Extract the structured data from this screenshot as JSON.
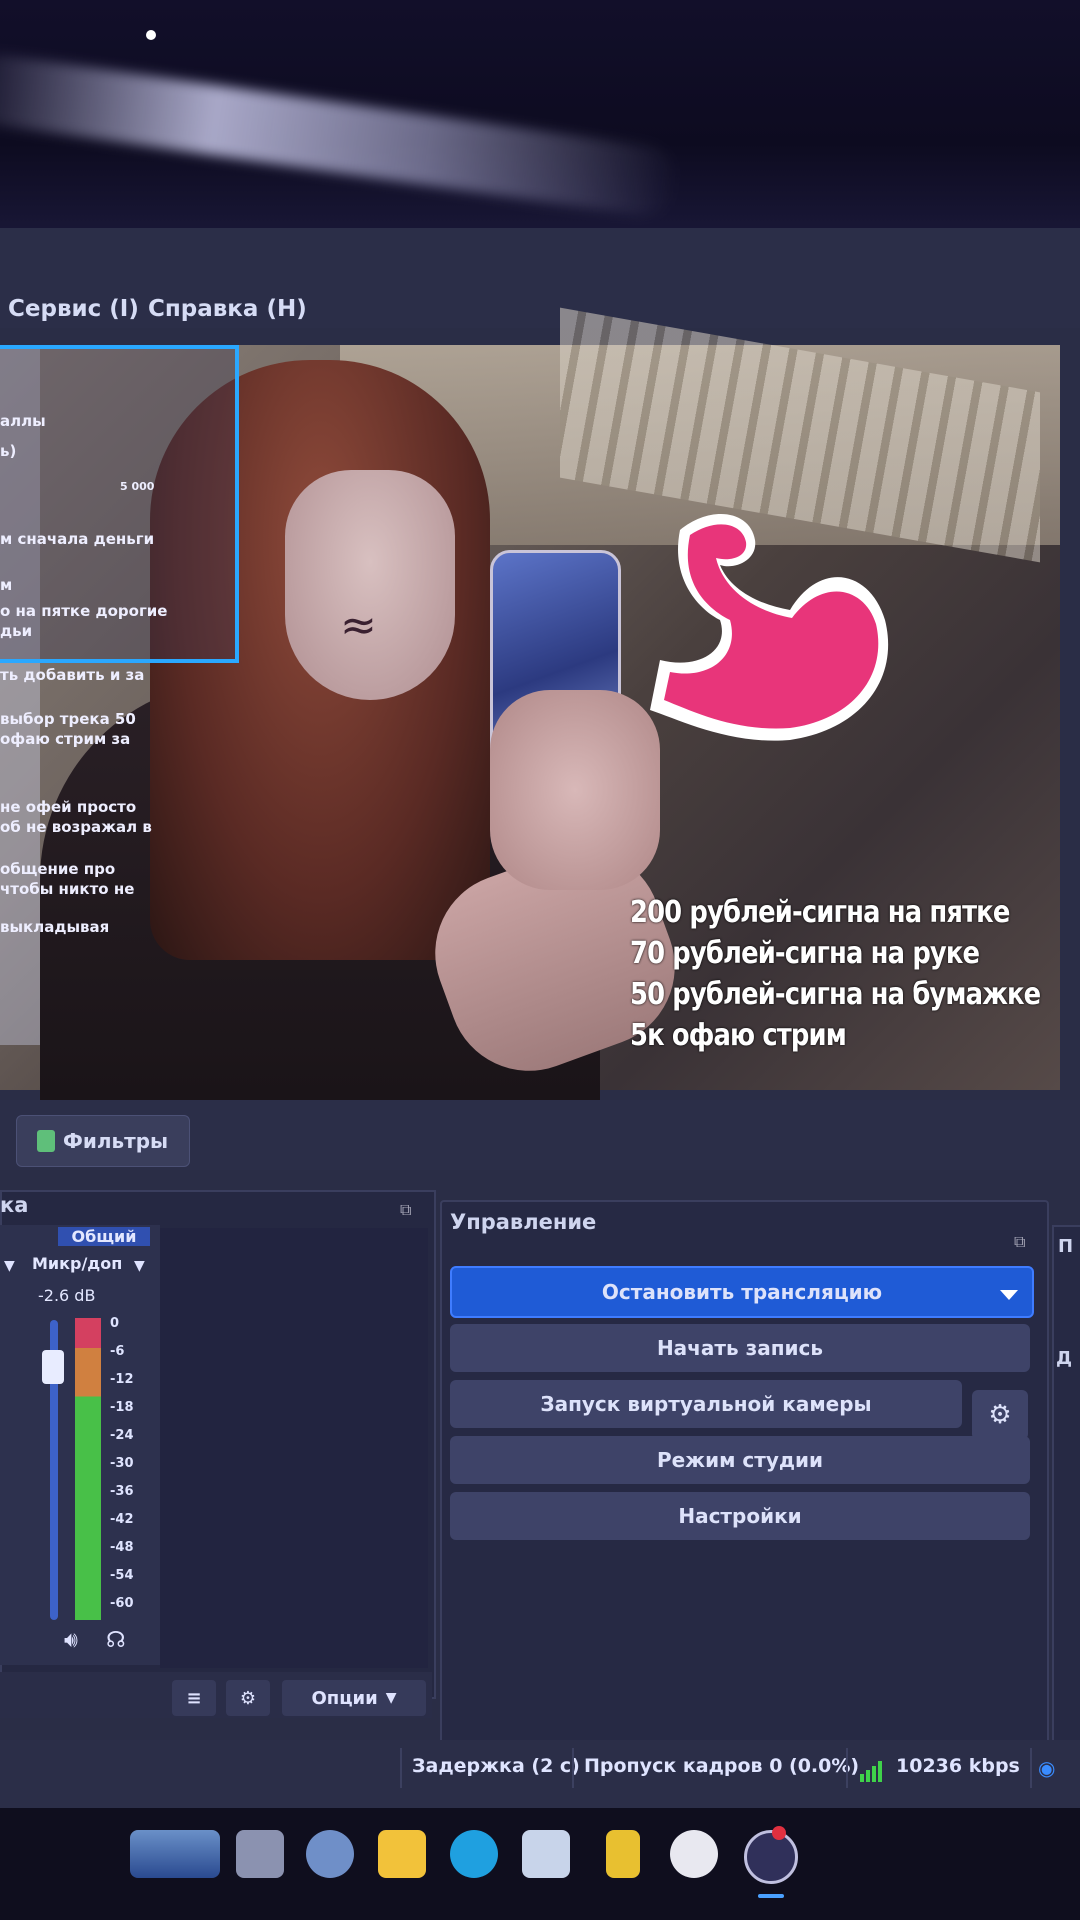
{
  "menu": {
    "items": [
      {
        "label": "Сервис (I)"
      },
      {
        "label": "Справка (H)"
      }
    ]
  },
  "preview": {
    "chat_lines": [
      "аллы",
      "ь)",
      "5 000",
      "м сначала деньги",
      "м",
      "о на пятке дорогие",
      "дьи",
      "ть добавить и за",
      "выбор трека 50",
      "офаю стрим за",
      "не офей просто",
      "об не возражал в",
      "общение про",
      "чтобы никто не",
      "выкладывая"
    ],
    "captions": [
      "200 рублей-сигна на пятке",
      "70 рублей-сигна на руке",
      "50 рублей-сигна на бумажке",
      "5к офаю стрим"
    ]
  },
  "toolbar": {
    "filters_label": "Фильтры"
  },
  "mixer": {
    "title": "ка",
    "group_label": "Общий",
    "channel_name": "Микр/доп",
    "level": "-2.6 dB",
    "level_fraction": 0.9,
    "scale": [
      "0",
      "-6",
      "-12",
      "-18",
      "-24",
      "-30",
      "-36",
      "-42",
      "-48",
      "-54",
      "-60"
    ],
    "options_label": "Опции"
  },
  "controls": {
    "title": "Управление",
    "buttons": {
      "stop_stream": "Остановить трансляцию",
      "start_record": "Начать запись",
      "virtual_cam": "Запуск виртуальной камеры",
      "studio_mode": "Режим студии",
      "settings": "Настройки"
    }
  },
  "right_dock": {
    "title": "П",
    "text": "Д"
  },
  "status": {
    "delay": "Задержка (2 с)",
    "dropped": "Пропуск кадров 0 (0.0%)",
    "bitrate": "10236 kbps"
  },
  "colors": {
    "accent_blue": "#1f5bd6",
    "selection_border": "#2aa8ff",
    "muscle_pink": "#e8357a"
  }
}
